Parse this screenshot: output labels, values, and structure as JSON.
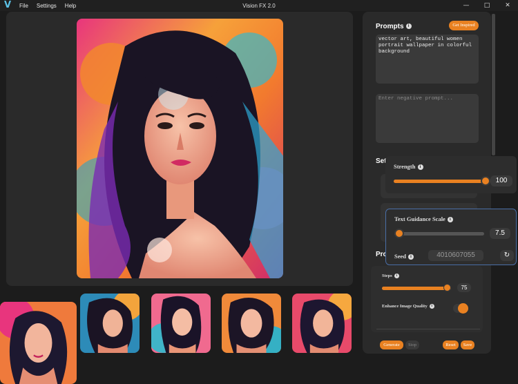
{
  "titlebar": {
    "title": "Vision FX 2.0",
    "menu": [
      "File",
      "Settings",
      "Help"
    ],
    "controls": [
      "minimize-icon",
      "maximize-icon",
      "close-icon"
    ]
  },
  "prompts": {
    "title": "Prompts",
    "inspire_label": "Get Inspired",
    "prompt_value": "vector art, beautiful women portrait wallpaper in colorful background",
    "negative_placeholder": "Enter negative prompt..."
  },
  "settings": {
    "title_partial": "Set",
    "strength_label": "Strength",
    "strength_value": "100",
    "strength_fraction": 1.0,
    "guidance_label": "Text Guidance Scale",
    "guidance_value": "7.5",
    "guidance_fraction": 0.05,
    "seed_label": "Seed",
    "seed_value": "4010607055"
  },
  "processing": {
    "title_partial": "Pro",
    "steps_label": "Steps",
    "steps_value": "75",
    "steps_fraction": 1.0,
    "enhance_label": "Enhance Image Quality",
    "enhance_on": true
  },
  "actions": {
    "generate": "Generate",
    "stop": "Stop",
    "reset": "Reset",
    "save": "Save"
  },
  "colors": {
    "accent": "#e98121",
    "panel": "#2a2a2a",
    "background": "#1c1c1c"
  }
}
